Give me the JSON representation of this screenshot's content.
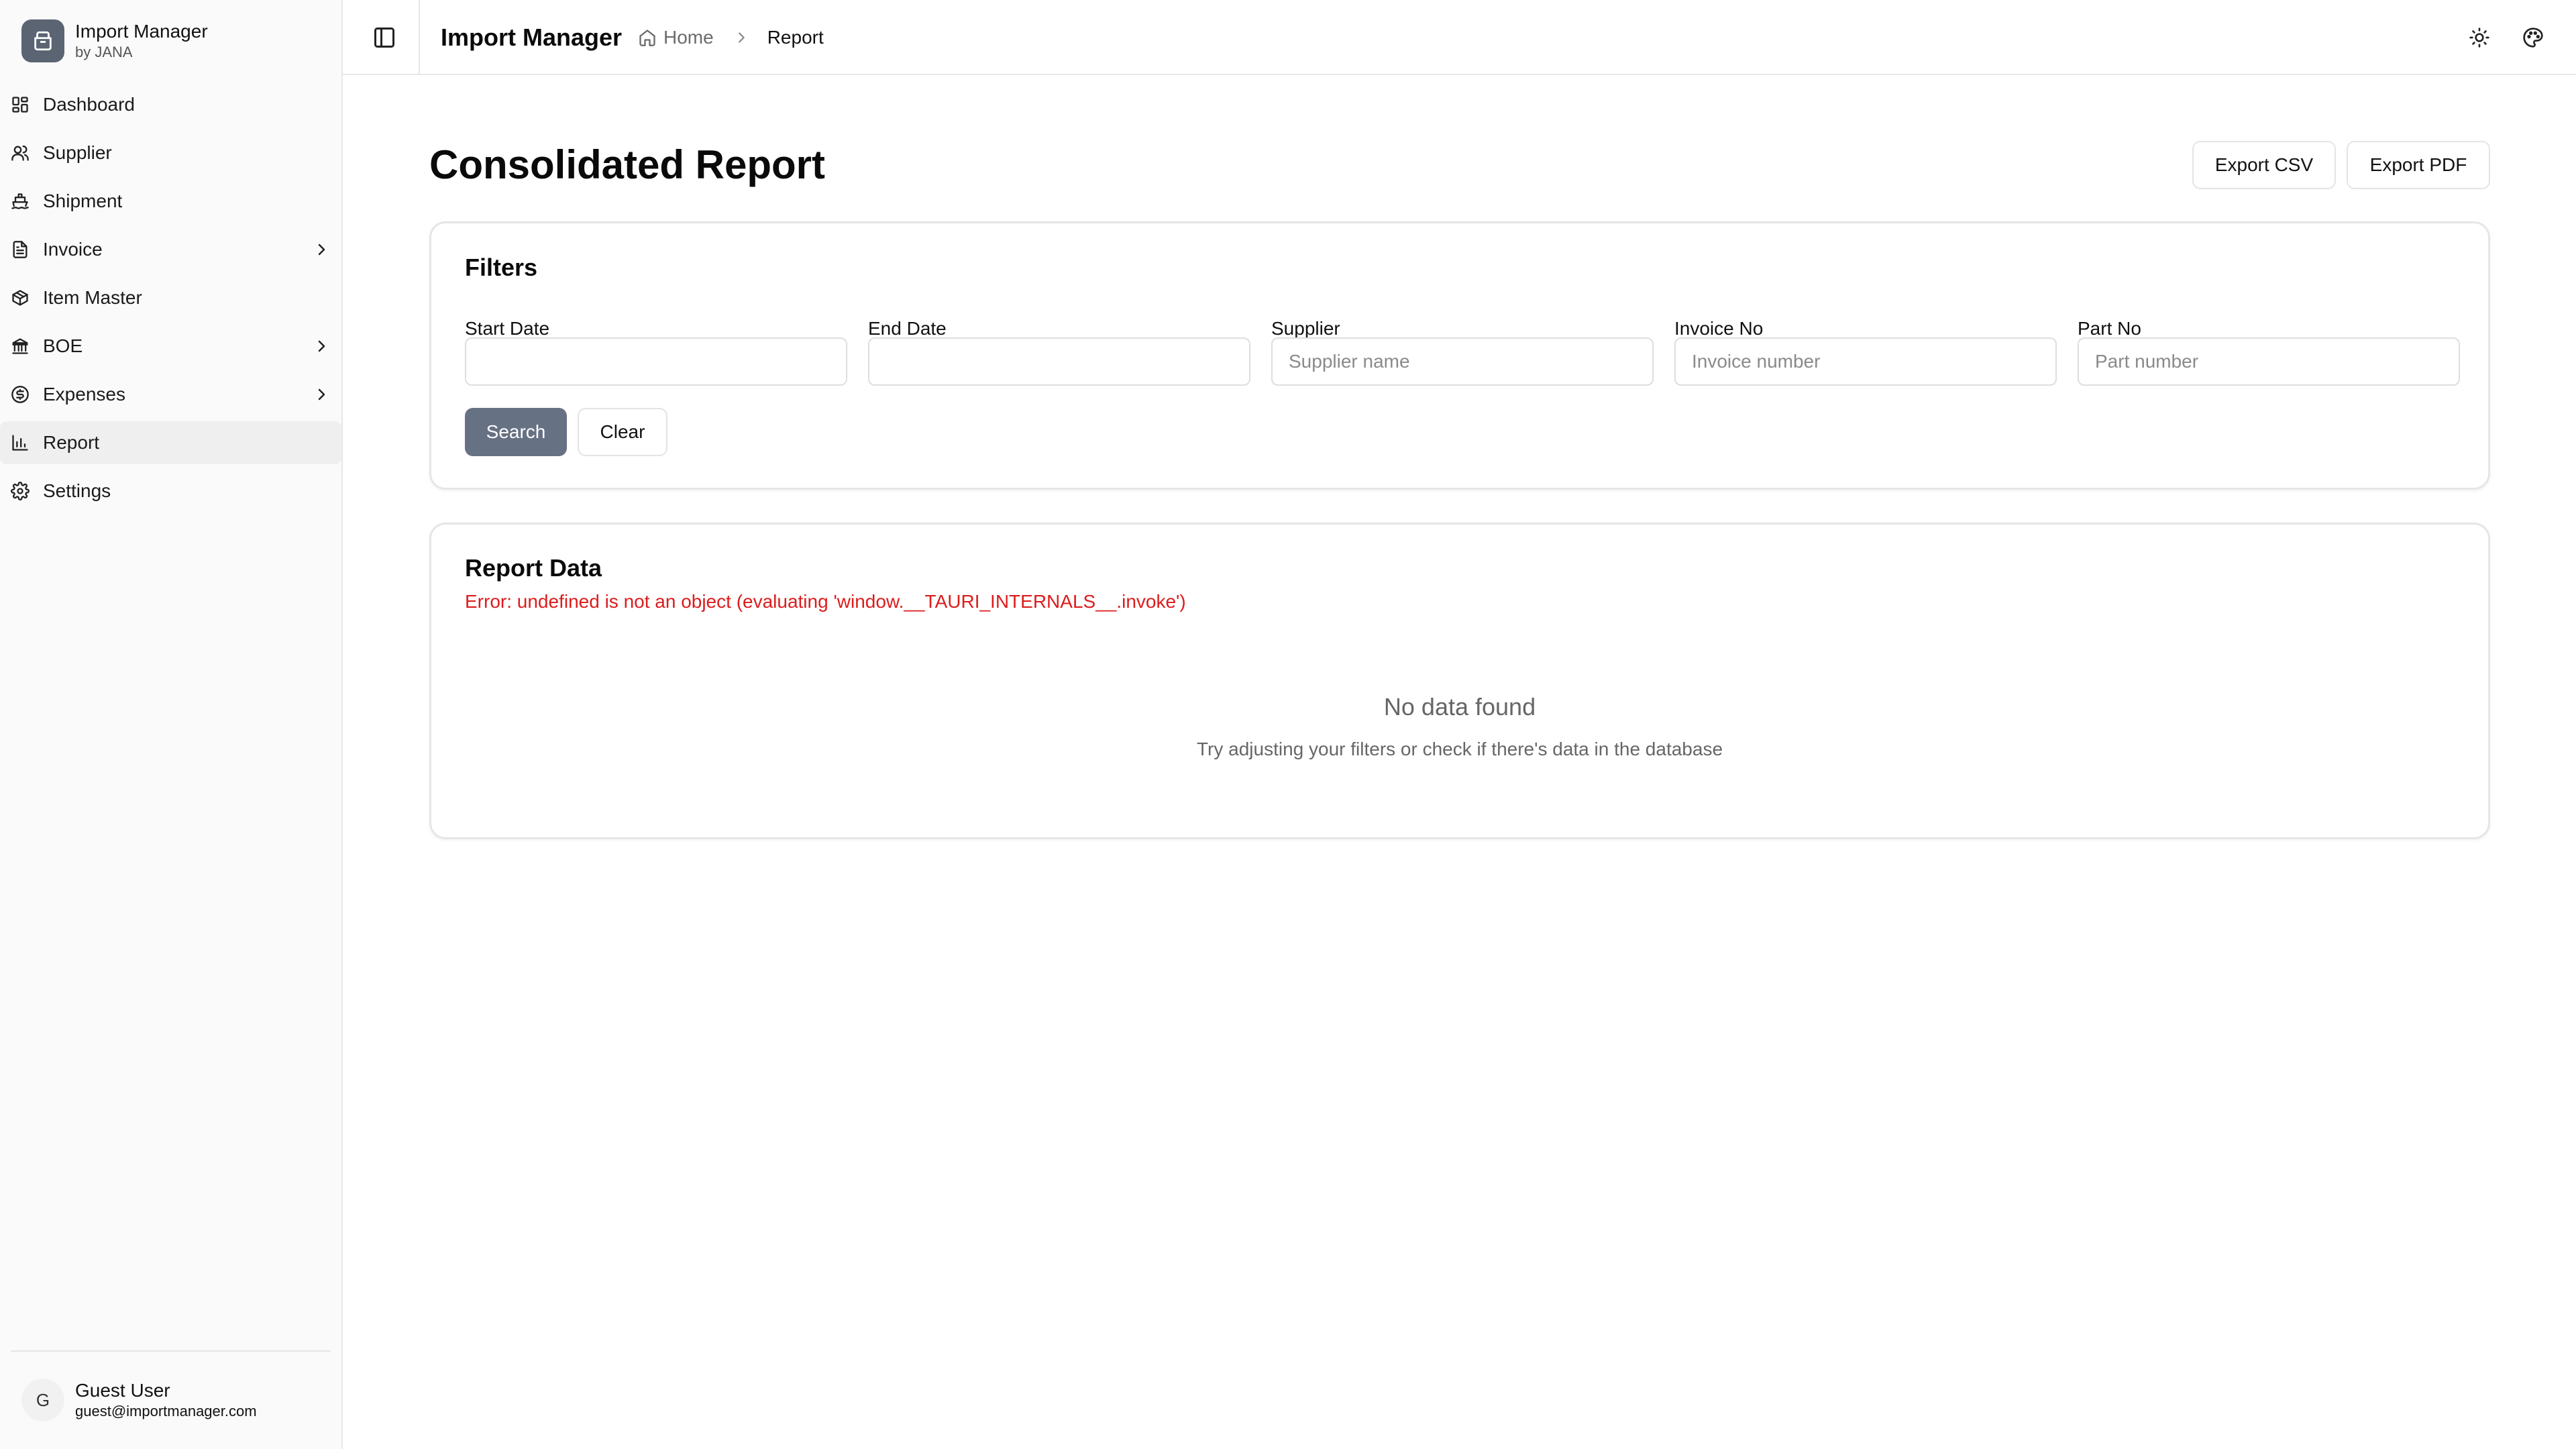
{
  "app": {
    "name": "Import Manager",
    "byline": "by JANA"
  },
  "sidebar": {
    "items": [
      {
        "label": "Dashboard",
        "icon": "dashboard-icon"
      },
      {
        "label": "Supplier",
        "icon": "users-icon"
      },
      {
        "label": "Shipment",
        "icon": "ship-icon"
      },
      {
        "label": "Invoice",
        "icon": "file-text-icon",
        "has_submenu": true
      },
      {
        "label": "Item Master",
        "icon": "package-icon"
      },
      {
        "label": "BOE",
        "icon": "bank-icon",
        "has_submenu": true
      },
      {
        "label": "Expenses",
        "icon": "dollar-circle-icon",
        "has_submenu": true
      },
      {
        "label": "Report",
        "icon": "bar-chart-icon",
        "active": true
      },
      {
        "label": "Settings",
        "icon": "gear-icon"
      }
    ]
  },
  "user": {
    "initial": "G",
    "name": "Guest User",
    "email": "guest@importmanager.com"
  },
  "header": {
    "title": "Import Manager",
    "breadcrumb": {
      "home": "Home",
      "current": "Report"
    }
  },
  "page": {
    "title": "Consolidated Report",
    "export_csv": "Export CSV",
    "export_pdf": "Export PDF"
  },
  "filters": {
    "title": "Filters",
    "fields": [
      {
        "label": "Start Date",
        "placeholder": "",
        "value": ""
      },
      {
        "label": "End Date",
        "placeholder": "",
        "value": ""
      },
      {
        "label": "Supplier",
        "placeholder": "Supplier name",
        "value": ""
      },
      {
        "label": "Invoice No",
        "placeholder": "Invoice number",
        "value": ""
      },
      {
        "label": "Part No",
        "placeholder": "Part number",
        "value": ""
      }
    ],
    "search_label": "Search",
    "clear_label": "Clear"
  },
  "report": {
    "title": "Report Data",
    "error": "Error: undefined is not an object (evaluating 'window.__TAURI_INTERNALS__.invoke')",
    "empty_title": "No data found",
    "empty_subtitle": "Try adjusting your filters or check if there's data in the database"
  },
  "colors": {
    "primary_button": "#677184",
    "error": "#dc1c1c",
    "sidebar_bg": "#fafafa",
    "active_item_bg": "#efefef"
  }
}
